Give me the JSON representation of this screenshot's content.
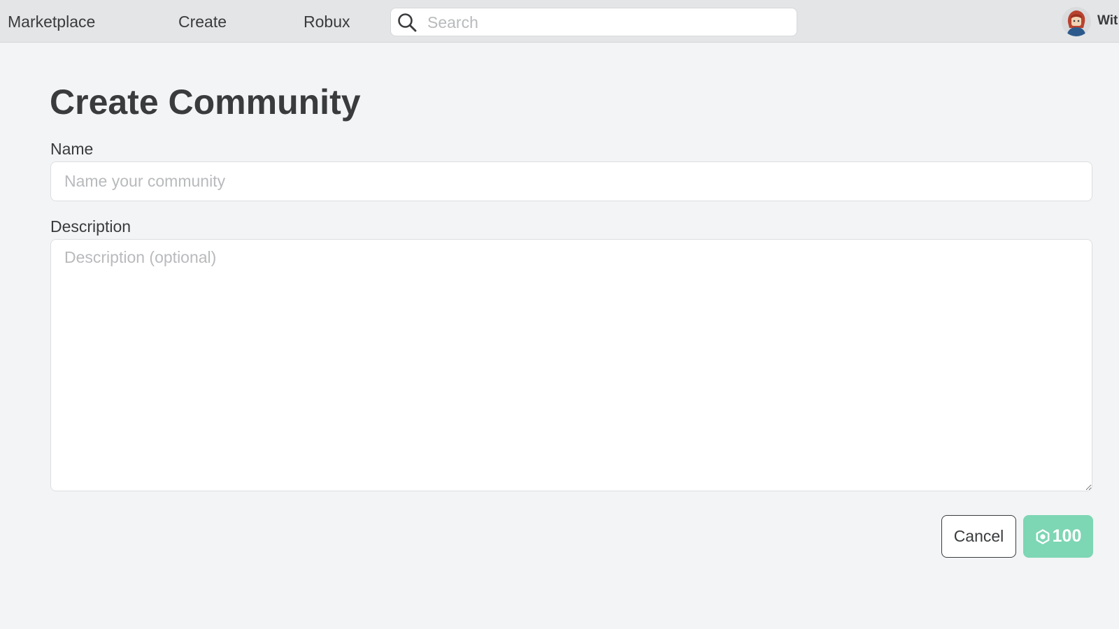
{
  "nav": {
    "items": [
      {
        "label": "Marketplace"
      },
      {
        "label": "Create"
      },
      {
        "label": "Robux"
      }
    ],
    "search": {
      "placeholder": "Search",
      "value": ""
    },
    "user": {
      "name": "Wit"
    }
  },
  "form": {
    "title": "Create Community",
    "name": {
      "label": "Name",
      "placeholder": "Name your community",
      "value": ""
    },
    "description": {
      "label": "Description",
      "placeholder": "Description (optional)",
      "value": ""
    },
    "cancel_label": "Cancel",
    "price": "100",
    "price_icon": "robux-icon"
  },
  "colors": {
    "topbar": "#e3e5e7",
    "background": "#f2f4f5",
    "primary_button": "#7dd6b4",
    "text": "#393b3d",
    "placeholder": "#b8babc"
  }
}
